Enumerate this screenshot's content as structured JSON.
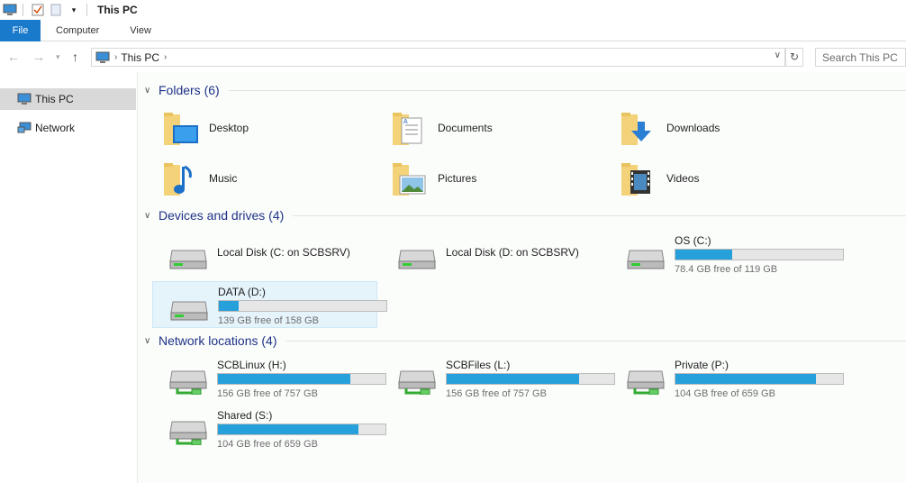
{
  "window": {
    "title": "This PC"
  },
  "ribbon": {
    "tabs": [
      "File",
      "Computer",
      "View"
    ]
  },
  "address": {
    "crumb": "This PC",
    "search_placeholder": "Search This PC"
  },
  "sidebar": {
    "items": [
      {
        "label": "This PC",
        "icon": "computer-icon"
      },
      {
        "label": "Network",
        "icon": "network-icon"
      }
    ]
  },
  "groups": {
    "folders": "Folders (6)",
    "devices": "Devices and drives (4)",
    "network": "Network locations (4)"
  },
  "folders": [
    {
      "label": "Desktop",
      "icon": "desktop-folder-icon"
    },
    {
      "label": "Documents",
      "icon": "documents-folder-icon"
    },
    {
      "label": "Downloads",
      "icon": "downloads-folder-icon"
    },
    {
      "label": "Music",
      "icon": "music-folder-icon"
    },
    {
      "label": "Pictures",
      "icon": "pictures-folder-icon"
    },
    {
      "label": "Videos",
      "icon": "videos-folder-icon"
    }
  ],
  "drives": [
    {
      "label": "Local Disk (C: on SCBSRV)",
      "free": "",
      "used_fraction": null
    },
    {
      "label": "Local Disk (D: on SCBSRV)",
      "free": "",
      "used_fraction": null
    },
    {
      "label": "OS (C:)",
      "free": "78.4 GB free of 119 GB",
      "used_fraction": 0.34
    },
    {
      "label": "DATA (D:)",
      "free": "139 GB free of 158 GB",
      "used_fraction": 0.12
    }
  ],
  "network_drives": [
    {
      "label": "SCBLinux (H:)",
      "free": "156 GB free of 757 GB",
      "used_fraction": 0.79
    },
    {
      "label": "SCBFiles (L:)",
      "free": "156 GB free of 757 GB",
      "used_fraction": 0.79
    },
    {
      "label": "Private (P:)",
      "free": "104 GB free of 659 GB",
      "used_fraction": 0.84
    },
    {
      "label": "Shared (S:)",
      "free": "104 GB free of 659 GB",
      "used_fraction": 0.84
    }
  ],
  "colors": {
    "accent": "#1979ca",
    "bar_fill": "#26a0da",
    "group_title": "#1e3287"
  }
}
